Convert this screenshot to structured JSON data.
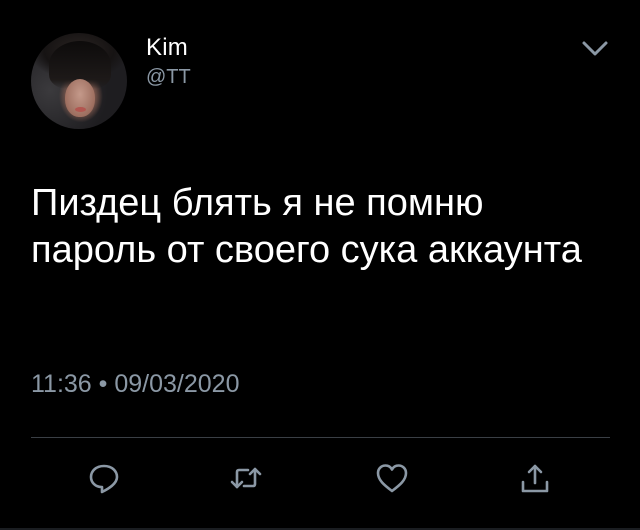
{
  "tweet": {
    "author_name": "Kim",
    "author_handle": "@TT",
    "text": "Пиздец блять я не помню пароль от своего сука аккаунта",
    "timestamp": "11:36 • 09/03/2020"
  },
  "icons": {
    "more": "chevron-down-icon",
    "reply": "reply-icon",
    "retweet": "retweet-icon",
    "like": "heart-icon",
    "share": "share-icon"
  },
  "colors": {
    "background": "#000000",
    "text_primary": "#ffffff",
    "text_secondary": "#8b98a5",
    "divider": "#3a3f45"
  }
}
